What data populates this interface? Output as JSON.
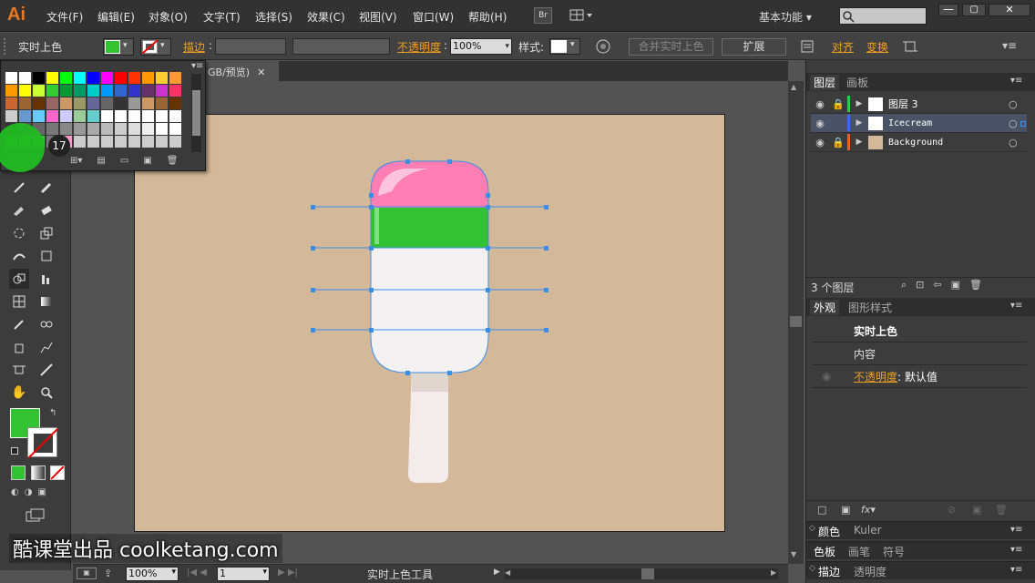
{
  "app": {
    "logo": "Ai",
    "workspace": "基本功能",
    "bridge": "Br"
  },
  "menu": [
    "文件(F)",
    "编辑(E)",
    "对象(O)",
    "文字(T)",
    "选择(S)",
    "效果(C)",
    "视图(V)",
    "窗口(W)",
    "帮助(H)"
  ],
  "control": {
    "tool_name": "实时上色",
    "stroke_label": "描边",
    "opacity_label": "不透明度",
    "opacity_value": "100%",
    "style_label": "样式",
    "merge_btn": "合并实时上色",
    "expand_btn": "扩展",
    "align_label": "对齐",
    "transform_label": "变换",
    "fill_color": "#33c233"
  },
  "doc_tab": {
    "title": "GB/预览)"
  },
  "swatch_popup": {
    "badge": "17"
  },
  "layers_panel": {
    "tabs": [
      "图层",
      "画板"
    ],
    "layers": [
      {
        "name": "图层 3",
        "color": "#2ecc40"
      },
      {
        "name": "Icecream",
        "color": "#3a6ee8"
      },
      {
        "name": "Background",
        "color": "#e8622a"
      }
    ],
    "count": "3 个图层"
  },
  "appearance_panel": {
    "tabs": [
      "外观",
      "图形样式"
    ],
    "title": "实时上色",
    "content": "内容",
    "opacity_label": "不透明度",
    "opacity_value": "默认值"
  },
  "color_panel": {
    "tabs": [
      "颜色",
      "Kuler"
    ]
  },
  "swatch_panel": {
    "tabs": [
      "色板",
      "画笔",
      "符号"
    ]
  },
  "stroke_panel": {
    "tabs": [
      "描边",
      "透明度"
    ]
  },
  "status": {
    "zoom": "100%",
    "page": "1",
    "tool": "实时上色工具"
  },
  "watermark": "酷课堂出品 coolketang.com"
}
